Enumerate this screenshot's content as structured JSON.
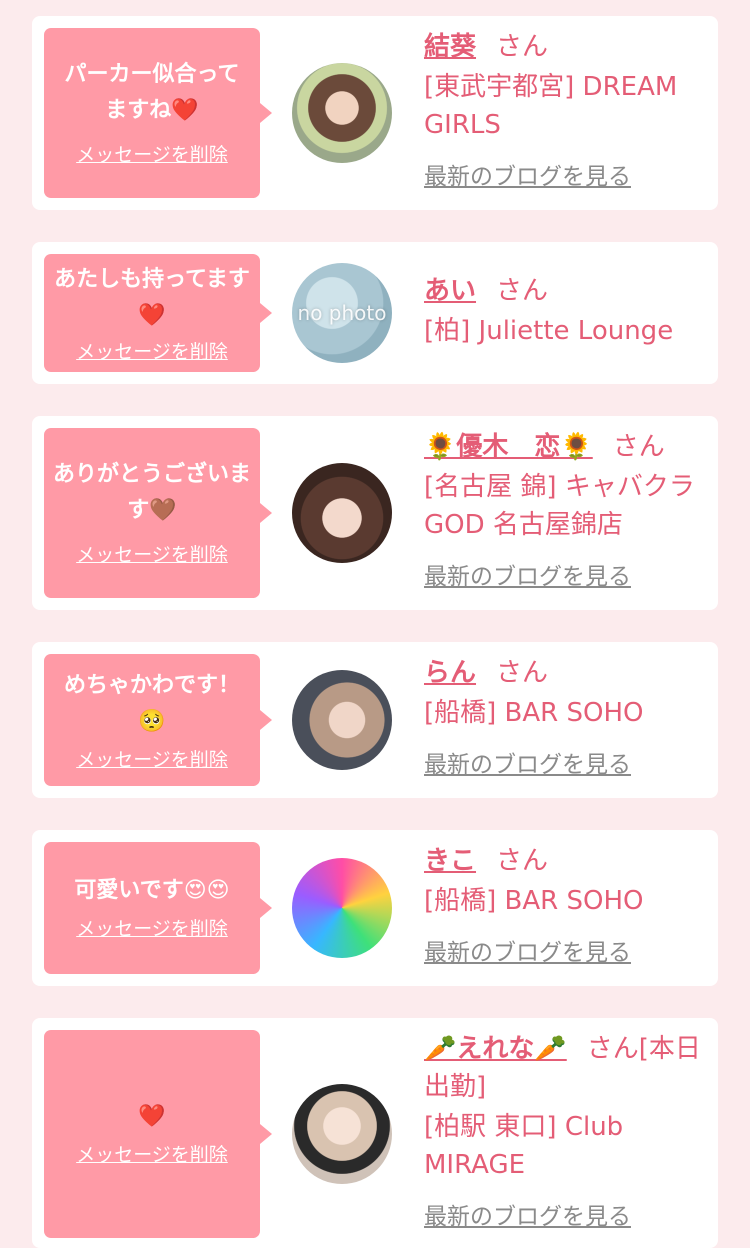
{
  "colors": {
    "background": "#fcebed",
    "card": "#ffffff",
    "bubble": "#ff9aa6",
    "accent_text": "#e45d76",
    "link_gray": "#8a8a8a"
  },
  "items": [
    {
      "message": "パーカー似合ってますね❤️",
      "delete_label": "メッセージを削除",
      "avatar_caption": "",
      "name": "結葵",
      "honorific": "さん",
      "shop": "[東武宇都宮] DREAM GIRLS",
      "blog_link": "最新のブログを見る"
    },
    {
      "message": "あたしも持ってます❤️",
      "delete_label": "メッセージを削除",
      "avatar_caption": "no photo",
      "name": "あい",
      "honorific": "さん",
      "shop": "[柏] Juliette Lounge",
      "blog_link": ""
    },
    {
      "message": "ありがとうございます🤎",
      "delete_label": "メッセージを削除",
      "avatar_caption": "",
      "name": "🌻優木　恋🌻",
      "honorific": "さん",
      "shop": "[名古屋 錦] キャバクラGOD 名古屋錦店",
      "blog_link": "最新のブログを見る"
    },
    {
      "message": "めちゃかわです！🥺",
      "delete_label": "メッセージを削除",
      "avatar_caption": "",
      "name": "らん",
      "honorific": "さん",
      "shop": "[船橋] BAR SOHO",
      "blog_link": "最新のブログを見る"
    },
    {
      "message": "可愛いです😍😍",
      "delete_label": "メッセージを削除",
      "avatar_caption": "",
      "name": "きこ",
      "honorific": "さん",
      "shop": "[船橋] BAR SOHO",
      "blog_link": "最新のブログを見る"
    },
    {
      "message": "❤️",
      "delete_label": "メッセージを削除",
      "avatar_caption": "",
      "name": "🥕えれな🥕",
      "honorific": "さん[本日出勤]",
      "shop": "[柏駅 東口] Club MIRAGE",
      "blog_link": "最新のブログを見る"
    }
  ]
}
